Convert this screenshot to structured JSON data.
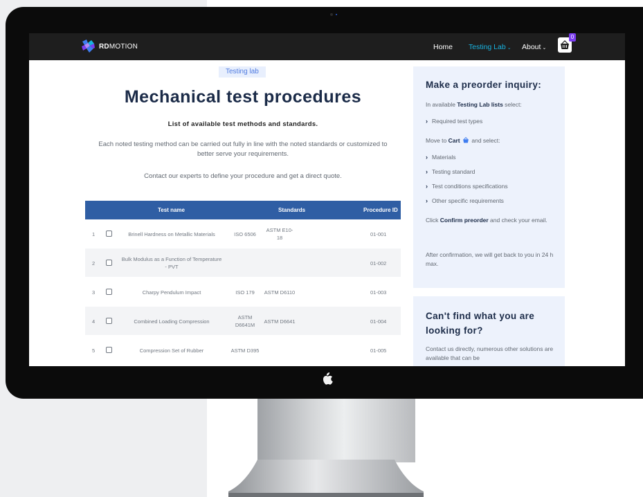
{
  "nav": {
    "brand_bold": "RD",
    "brand_rest": "MOTION",
    "home": "Home",
    "testing_lab": "Testing Lab",
    "about": "About",
    "caret": "⌄",
    "cart_count": "0"
  },
  "hero": {
    "tag": "Testing lab",
    "title": "Mechanical test procedures",
    "subtitle": "List of available test methods and standards.",
    "paragraph": "Each noted testing method can be carried out fully in line with the noted standards or customized to better serve your requirements.",
    "contact": "Contact our experts to define your procedure and get a direct quote."
  },
  "table": {
    "headers": {
      "name": "Test name",
      "standards": "Standards",
      "procedure": "Procedure ID"
    },
    "rows": [
      {
        "num": "1",
        "name": "Brinell Hardness on Metallic Materials",
        "s1": "ISO 6506",
        "s2": "ASTM E10-18",
        "pid": "01-001"
      },
      {
        "num": "2",
        "name": "Bulk Modulus as a Function of Temperature - PVT",
        "s1": "",
        "s2": "",
        "pid": "01-002"
      },
      {
        "num": "3",
        "name": "Charpy Pendulum Impact",
        "s1": "ISO 179",
        "s2": "ASTM D6110",
        "pid": "01-003"
      },
      {
        "num": "4",
        "name": "Combined Loading Compression",
        "s1": "ASTM D6641M",
        "s2": "ASTM D6641",
        "pid": "01-004"
      },
      {
        "num": "5",
        "name": "Compression Set of Rubber",
        "s1": "ASTM D395",
        "s2": "",
        "pid": "01-005"
      }
    ]
  },
  "preorder": {
    "title": "Make a preorder inquiry:",
    "intro_pre": "In available ",
    "intro_bold": "Testing Lab lists",
    "intro_post": " select:",
    "item_required": "Required test types",
    "move_pre": "Move to ",
    "move_bold": "Cart",
    "move_post": " and select:",
    "items": [
      "Materials",
      "Testing standard",
      "Test conditions specifications",
      "Other specific requirements"
    ],
    "confirm_pre": "Click ",
    "confirm_bold": "Confirm preorder",
    "confirm_post": " and check your email.",
    "after": "After confirmation, we will get back to you in 24 h max."
  },
  "cantfind": {
    "title": "Can't find what you are looking for?",
    "text": "Contact us directly, numerous other solutions are available that can be"
  },
  "colors": {
    "accent": "#19b3e0",
    "table_header": "#2f5ea4",
    "panel_bg": "#edf2fc",
    "heading": "#1b2b48",
    "badge": "#7b3df0"
  },
  "icons": {
    "logo": "rdmotion-logo-icon",
    "cart": "basket-icon",
    "chevron": "chevron-right-icon",
    "apple": "apple-logo-icon"
  }
}
